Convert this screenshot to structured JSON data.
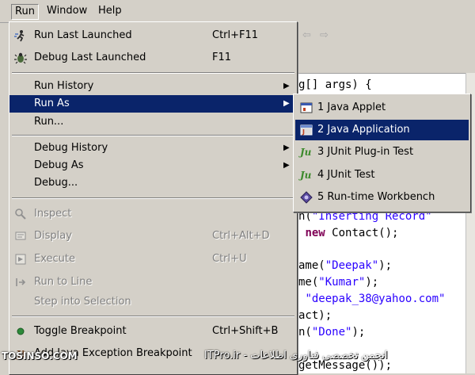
{
  "menubar": {
    "run": "Run",
    "window": "Window",
    "help": "Help"
  },
  "run_menu": {
    "run_last_launched": {
      "label": "Run Last Launched",
      "accel": "Ctrl+F11"
    },
    "debug_last_launched": {
      "label": "Debug Last Launched",
      "accel": "F11"
    },
    "run_history": {
      "label": "Run History"
    },
    "run_as": {
      "label": "Run As"
    },
    "run_dots": {
      "label": "Run..."
    },
    "debug_history": {
      "label": "Debug History"
    },
    "debug_as": {
      "label": "Debug As"
    },
    "debug_dots": {
      "label": "Debug..."
    },
    "inspect": {
      "label": "Inspect"
    },
    "display": {
      "label": "Display",
      "accel": "Ctrl+Alt+D"
    },
    "execute": {
      "label": "Execute",
      "accel": "Ctrl+U"
    },
    "run_to_line": {
      "label": "Run to Line"
    },
    "step_into_selection": {
      "label": "Step into Selection"
    },
    "toggle_breakpoint": {
      "label": "Toggle Breakpoint",
      "accel": "Ctrl+Shift+B"
    },
    "add_java_exception_breakpoint": {
      "label": "Add Java Exception Breakpoint"
    }
  },
  "run_as_submenu": {
    "items": [
      {
        "label": "1 Java Applet",
        "icon": "java-applet-icon"
      },
      {
        "label": "2 Java Application",
        "icon": "java-application-icon"
      },
      {
        "label": "3 JUnit Plug-in Test",
        "icon": "junit-plugin-icon"
      },
      {
        "label": "4 JUnit Test",
        "icon": "junit-icon"
      },
      {
        "label": "5 Run-time Workbench",
        "icon": "workbench-icon"
      }
    ]
  },
  "editor": {
    "line1": "g[] args) {",
    "line2_pre": "n(",
    "line2_str": "\"Inserting Record\"",
    "line3_kw": "new",
    "line3_rest": " Contact();",
    "line4_pre": "ame(",
    "line4_str": "\"Deepak\"",
    "line4_post": ");",
    "line5_pre": "me(",
    "line5_str": "\"Kumar\"",
    "line5_post": ");",
    "line6_str": "\"deepak_38@yahoo.com\"",
    "line7": "act);",
    "line8_pre": "n(",
    "line8_str": "\"Done\"",
    "line8_post": ");",
    "line9": "getMessage());"
  },
  "watermark": {
    "left": "TOSINSO.COM",
    "right": "ITPro.ir - انجمن تخصصی فناوری اطلاعات"
  },
  "colors": {
    "selection": "#0a246a",
    "menu_bg": "#d4d0c8",
    "string": "#2a00ff",
    "keyword": "#7f0055"
  }
}
